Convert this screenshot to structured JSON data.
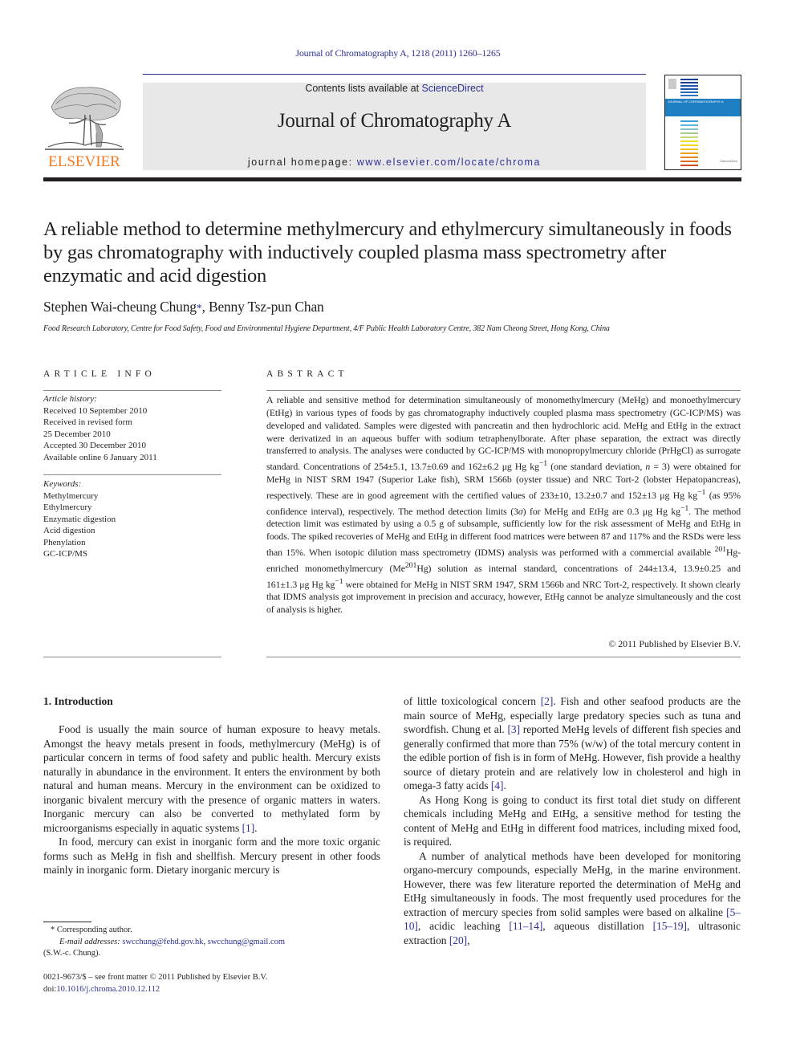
{
  "header": {
    "citation": "Journal of Chromatography A, 1218 (2011) 1260–1265",
    "contents_prefix": "Contents lists available at ",
    "contents_link": "ScienceDirect",
    "journal_title": "Journal of Chromatography A",
    "homepage_prefix": "journal homepage: ",
    "homepage_link": "www.elsevier.com/locate/chroma",
    "publisher": "ELSEVIER",
    "cover_title": "JOURNAL OF CHROMATOGRAPHY A",
    "colors": {
      "link": "#2e3192",
      "publisher_orange": "#f47920",
      "masthead_bg": "#e8e8e9",
      "cover_band": "#1d7ec2"
    }
  },
  "article": {
    "title": "A reliable method to determine methylmercury and ethylmercury simultaneously in foods by gas chromatography with inductively coupled plasma mass spectrometry after enzymatic and acid digestion",
    "authors": [
      {
        "name": "Stephen Wai-cheung Chung",
        "mark": "*"
      },
      {
        "name": "Benny Tsz-pun Chan",
        "mark": ""
      }
    ],
    "author_separator": ", ",
    "affiliation": "Food Research Laboratory, Centre for Food Safety, Food and Environmental Hygiene Department, 4/F Public Health Laboratory Centre, 382 Nam Cheong Street, Hong Kong, China"
  },
  "article_info": {
    "heading": "ARTICLE INFO",
    "history_label": "Article history:",
    "history": [
      "Received 10 September 2010",
      "Received in revised form",
      "25 December 2010",
      "Accepted 30 December 2010",
      "Available online 6 January 2011"
    ],
    "keywords_label": "Keywords:",
    "keywords": [
      "Methylmercury",
      "Ethylmercury",
      "Enzymatic digestion",
      "Acid digestion",
      "Phenylation",
      "GC-ICP/MS"
    ]
  },
  "abstract": {
    "heading": "ABSTRACT",
    "p1": "A reliable and sensitive method for determination simultaneously of monomethylmercury (MeHg) and monoethylmercury (EtHg) in various types of foods by gas chromatography inductively coupled plasma mass spectrometry (GC-ICP/MS) was developed and validated. Samples were digested with pancreatin and then hydrochloric acid. MeHg and EtHg in the extract were derivatized in an aqueous buffer with sodium tetraphenylborate. After phase separation, the extract was directly transferred to analysis. The analyses were conducted by GC-ICP/MS with monopropylmercury chloride (PrHgCl) as surrogate standard. Concentrations of 254±5.1, 13.7±0.69 and 162±6.2 μg Hg kg",
    "p1_sup": "−1",
    "p2": " (one standard deviation, ",
    "p2_n": "n",
    "p3": " = 3) were obtained for MeHg in NIST SRM 1947 (Superior Lake fish), SRM 1566b (oyster tissue) and NRC Tort-2 (lobster Hepatopancreas), respectively. These are in good agreement with the certified values of 233±10, 13.2±0.7 and 152±13 μg Hg kg",
    "p3_sup": "−1",
    "p4": " (as 95% confidence interval), respectively. The method detection limits (3",
    "p4_sigma": "σ",
    "p5": ") for MeHg and EtHg are 0.3 μg Hg kg",
    "p5_sup": "−1",
    "p6": ". The method detection limit was estimated by using a 0.5 g of subsample, sufficiently low for the risk assessment of MeHg and EtHg in foods. The spiked recoveries of MeHg and EtHg in different food matrices were between 87 and 117% and the RSDs were less than 15%. When isotopic dilution mass spectrometry (IDMS) analysis was performed with a commercial available ",
    "p6_sup": "201",
    "p7": "Hg-enriched monomethylmercury (Me",
    "p7_sup": "201",
    "p8": "Hg) solution as internal standard, concentrations of 244±13.4, 13.9±0.25 and 161±1.3 μg Hg kg",
    "p8_sup": "−1",
    "p9": " were obtained for MeHg in NIST SRM 1947, SRM 1566b and NRC Tort-2, respectively. It shown clearly that IDMS analysis got improvement in precision and accuracy, however, EtHg cannot be analyze simultaneously and the cost of analysis is higher.",
    "copyright": "© 2011 Published by Elsevier B.V."
  },
  "body": {
    "section_heading": "1.  Introduction",
    "left": {
      "para1_a": "Food is usually the main source of human exposure to heavy metals. Amongst the heavy metals present in foods, methylmercury (MeHg) is of particular concern in terms of food safety and public health. Mercury exists naturally in abundance in the environment. It enters the environment by both natural and human means. Mercury in the environment can be oxidized to inorganic bivalent mercury with the presence of organic matters in waters. Inorganic mercury can also be converted to methylated form by microorganisms especially in aquatic systems ",
      "para1_ref": "[1]",
      "para1_b": ".",
      "para2": "In food, mercury can exist in inorganic form and the more toxic organic forms such as MeHg in fish and shellfish. Mercury present in other foods mainly in inorganic form. Dietary inorganic mercury is"
    },
    "right": {
      "para1_a": "of little toxicological concern ",
      "para1_ref1": "[2]",
      "para1_b": ". Fish and other seafood products are the main source of MeHg, especially large predatory species such as tuna and swordfish. Chung et al. ",
      "para1_ref2": "[3]",
      "para1_c": " reported MeHg levels of different fish species and generally confirmed that more than 75% (w/w) of the total mercury content in the edible portion of fish is in form of MeHg. However, fish provide a healthy source of dietary protein and are relatively low in cholesterol and high in omega-3 fatty acids ",
      "para1_ref3": "[4]",
      "para1_d": ".",
      "para2": "As Hong Kong is going to conduct its first total diet study on different chemicals including MeHg and EtHg, a sensitive method for testing the content of MeHg and EtHg in different food matrices, including mixed food, is required.",
      "para3_a": "A number of analytical methods have been developed for monitoring organo-mercury compounds, especially MeHg, in the marine environment. However, there was few literature reported the determination of MeHg and EtHg simultaneously in foods. The most frequently used procedures for the extraction of mercury species from solid samples were based on alkaline ",
      "para3_ref1": "[5–10]",
      "para3_b": ", acidic leaching ",
      "para3_ref2": "[11–14]",
      "para3_c": ", aqueous distillation ",
      "para3_ref3": "[15–19]",
      "para3_d": ", ultrasonic extraction ",
      "para3_ref4": "[20]",
      "para3_e": ","
    }
  },
  "footnote": {
    "star_line": "* Corresponding author.",
    "email_label": "E-mail addresses:",
    "email1": "swcchung@fehd.gov.hk",
    "email_sep": ", ",
    "email2": "swcchung@gmail.com",
    "name_line": "(S.W.-c. Chung).",
    "frontmatter": "0021-9673/$ – see front matter © 2011 Published by Elsevier B.V.",
    "doi_prefix": "doi:",
    "doi": "10.1016/j.chroma.2010.12.112"
  }
}
